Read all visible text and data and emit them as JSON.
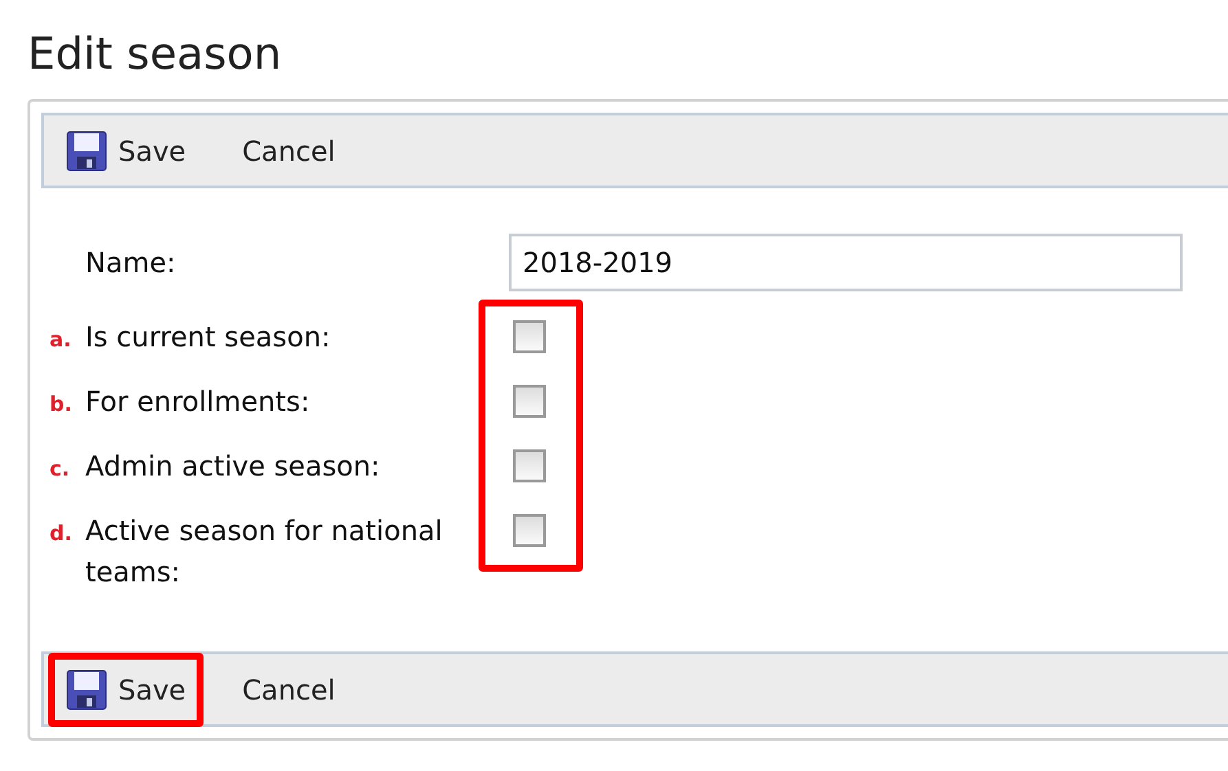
{
  "page": {
    "title": "Edit season"
  },
  "top_toolbar": {
    "buttons": [
      {
        "kind": "save",
        "label": "Save",
        "highlighted": false
      },
      {
        "kind": "plain",
        "label": "Cancel",
        "highlighted": false
      }
    ]
  },
  "form": {
    "name_field": {
      "label": "Name:",
      "value": "2018-2019"
    },
    "checkbox_group_highlighted": true,
    "checkboxes": [
      {
        "marker": "a.",
        "label": "Is current season:",
        "checked": false
      },
      {
        "marker": "b.",
        "label": "For enrollments:",
        "checked": false
      },
      {
        "marker": "c.",
        "label": "Admin active season:",
        "checked": false
      },
      {
        "marker": "d.",
        "label": "Active season for national teams:",
        "checked": false
      }
    ]
  },
  "bottom_toolbar": {
    "buttons": [
      {
        "kind": "save",
        "label": "Save",
        "highlighted": true
      },
      {
        "kind": "plain",
        "label": "Cancel",
        "highlighted": false
      }
    ]
  }
}
